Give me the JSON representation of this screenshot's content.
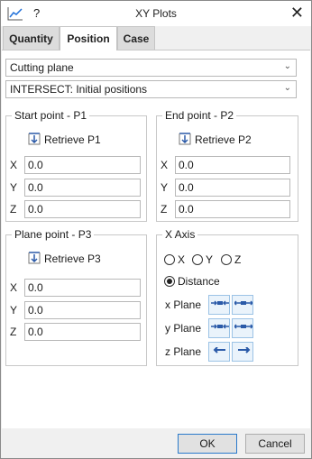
{
  "window": {
    "title": "XY Plots",
    "help": "?",
    "close": "✕"
  },
  "tabs": [
    {
      "label": "Quantity",
      "active": false
    },
    {
      "label": "Position",
      "active": true
    },
    {
      "label": "Case",
      "active": false
    }
  ],
  "selects": {
    "plane_type": "Cutting plane",
    "intersect": "INTERSECT: Initial positions"
  },
  "start_point": {
    "title": "Start point - P1",
    "retrieve": "Retrieve P1",
    "x_label": "X",
    "x": "0.0",
    "y_label": "Y",
    "y": "0.0",
    "z_label": "Z",
    "z": "0.0"
  },
  "end_point": {
    "title": "End point - P2",
    "retrieve": "Retrieve P2",
    "x_label": "X",
    "x": "0.0",
    "y_label": "Y",
    "y": "0.0",
    "z_label": "Z",
    "z": "0.0"
  },
  "plane_point": {
    "title": "Plane point - P3",
    "retrieve": "Retrieve P3",
    "x_label": "X",
    "x": "0.0",
    "y_label": "Y",
    "y": "0.0",
    "z_label": "Z",
    "z": "0.0"
  },
  "x_axis": {
    "title": "X Axis",
    "options": [
      "X",
      "Y",
      "Z"
    ],
    "distance": "Distance",
    "selected": "Distance",
    "x_plane": "x Plane",
    "y_plane": "y Plane",
    "z_plane": "z Plane"
  },
  "buttons": {
    "ok": "OK",
    "cancel": "Cancel"
  },
  "colors": {
    "accent": "#1e6fd9",
    "button_icon": "#2b5aa8"
  }
}
